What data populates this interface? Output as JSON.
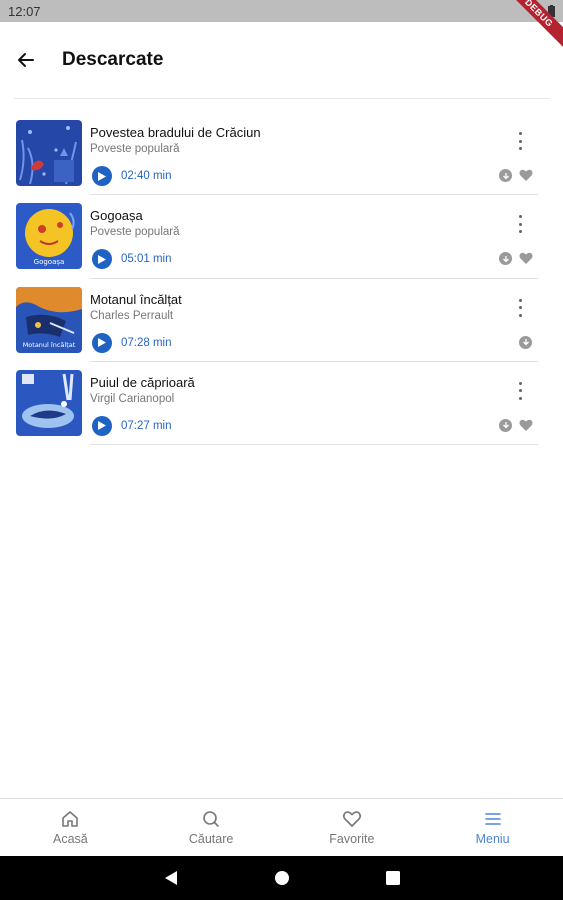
{
  "status_bar": {
    "time": "12:07",
    "debug_label": "DEBUG"
  },
  "header": {
    "title": "Descarcate"
  },
  "items": [
    {
      "title": "Povestea bradului de Crăciun",
      "author": "Poveste populară",
      "duration": "02:40 min",
      "thumb_text": "Povestea bradului de Crăciun",
      "favorite": true
    },
    {
      "title": "Gogoașa",
      "author": "Poveste populară",
      "duration": "05:01 min",
      "thumb_text": "Gogoașa",
      "favorite": true
    },
    {
      "title": "Motanul încălțat",
      "author": "Charles Perrault",
      "duration": "07:28 min",
      "thumb_text": "Motanul încălțat",
      "favorite": false
    },
    {
      "title": "Puiul de căprioară",
      "author": "Virgil Carianopol",
      "duration": "07:27 min",
      "thumb_text": "",
      "favorite": true
    }
  ],
  "bottom_nav": [
    {
      "label": "Acasă",
      "icon": "home-icon",
      "active": false
    },
    {
      "label": "Căutare",
      "icon": "search-icon",
      "active": false
    },
    {
      "label": "Favorite",
      "icon": "heart-outline-icon",
      "active": false
    },
    {
      "label": "Meniu",
      "icon": "menu-icon",
      "active": true
    }
  ],
  "colors": {
    "accent": "#1e63c4",
    "active_nav": "#4f86d6",
    "duration_text": "#2764c4"
  }
}
